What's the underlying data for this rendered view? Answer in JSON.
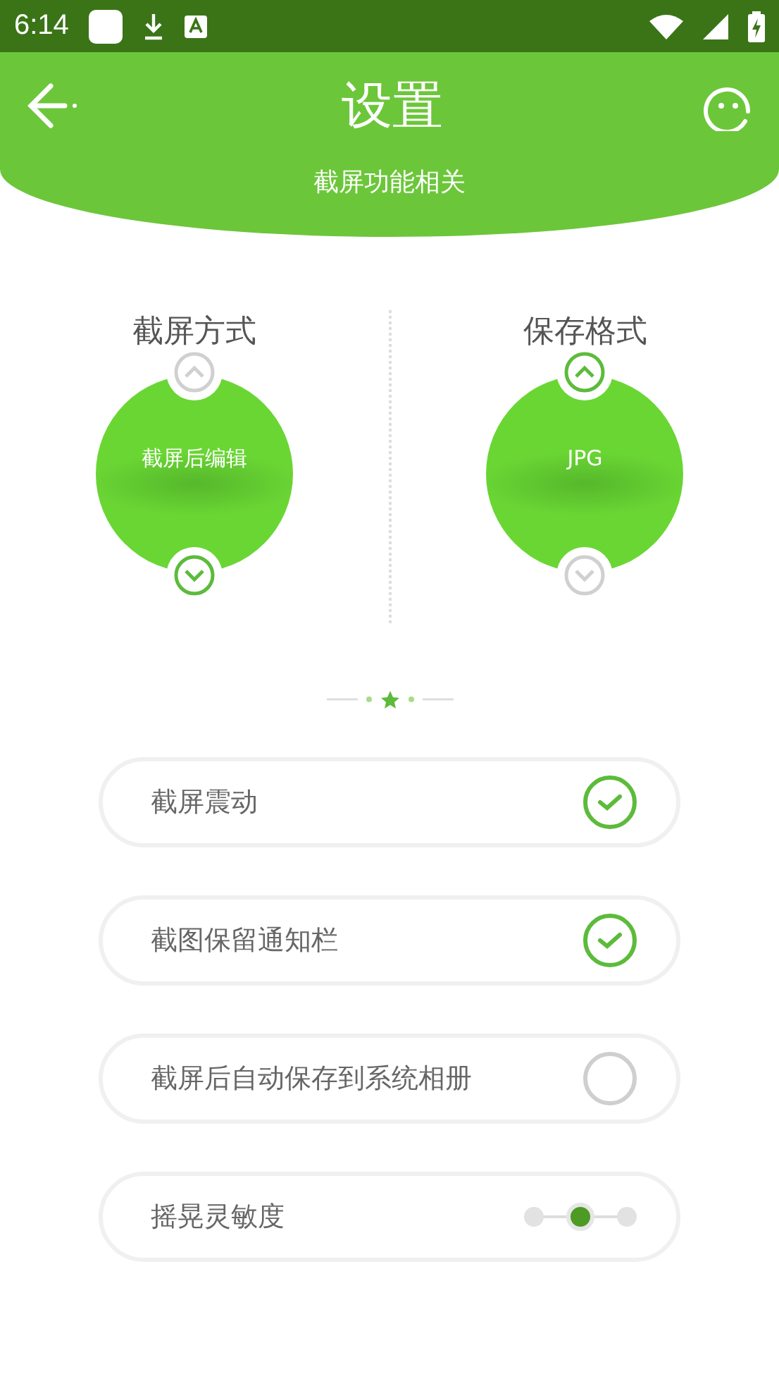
{
  "status_bar": {
    "time": "6:14"
  },
  "header": {
    "title": "设置",
    "subtitle": "截屏功能相关"
  },
  "pickers": [
    {
      "title": "截屏方式",
      "value": "截屏后编辑",
      "up_enabled": false,
      "down_enabled": true
    },
    {
      "title": "保存格式",
      "value": "JPG",
      "up_enabled": true,
      "down_enabled": false
    }
  ],
  "settings": [
    {
      "kind": "check",
      "label": "截屏震动",
      "checked": true
    },
    {
      "kind": "check",
      "label": "截图保留通知栏",
      "checked": true
    },
    {
      "kind": "check",
      "label": "截屏后自动保存到系统相册",
      "checked": false
    },
    {
      "kind": "steps",
      "label": "摇晃灵敏度",
      "level": 0.5
    }
  ]
}
